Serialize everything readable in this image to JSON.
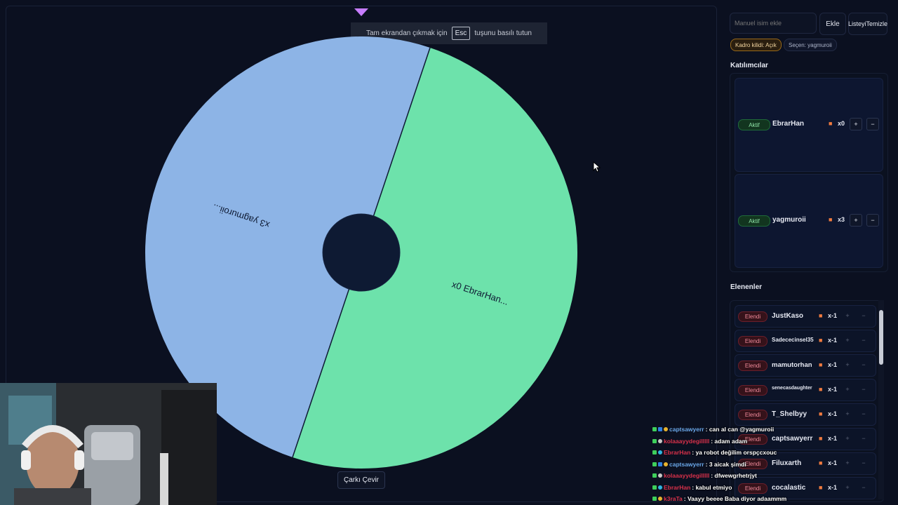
{
  "esc_hint": {
    "before": "Tam ekrandan çıkmak için",
    "key": "Esc",
    "after": "tuşunu basılı tutun"
  },
  "wheel": {
    "segments": [
      {
        "label": "x3 yagmuroii...",
        "color": "#8db4e6"
      },
      {
        "label": "x0 EbrarHan...",
        "color": "#6de2ab"
      }
    ],
    "border_color": "#c2123e",
    "hub_color": "#0e1a33"
  },
  "spin_button": "Çarkı Çevir",
  "panel": {
    "name_placeholder": "Manuel isim ekle",
    "add_label": "Ekle",
    "clear_label_1": "Listeyi",
    "clear_label_2": "Temizle",
    "lock_pill": "Kadro kilidi: Açık",
    "selected_pill": "Seçen: yagmuroii",
    "participants_title": "Katılımcılar",
    "eliminated_title": "Elenenler",
    "active_badge": "Aktif",
    "elim_badge": "Elendi",
    "participants": [
      {
        "name": "EbrarHan",
        "mult": "x0"
      },
      {
        "name": "yagmuroii",
        "mult": "x3"
      }
    ],
    "eliminated": [
      {
        "name": "JustKaso",
        "mult": "x-1"
      },
      {
        "name": "Sadececinsel35",
        "mult": "x-1"
      },
      {
        "name": "mamutorhan",
        "mult": "x-1"
      },
      {
        "name": "senecasdaughter",
        "mult": "x-1"
      },
      {
        "name": "T_Shelbyy",
        "mult": "x-1"
      },
      {
        "name": "captsawyerr",
        "mult": "x-1"
      },
      {
        "name": "Filuxarth",
        "mult": "x-1"
      },
      {
        "name": "cocalastic",
        "mult": "x-1"
      }
    ],
    "plus": "+",
    "minus": "−"
  },
  "chat": [
    {
      "user": "captsawyerr",
      "color": "#6aa7e8",
      "msg": ": can al can @yagmuroii"
    },
    {
      "user": "kolaaayydegilllll",
      "color": "#d9314a",
      "msg": ": adam adam"
    },
    {
      "user": "EbrarHan",
      "color": "#d9314a",
      "msg": ": ya robot değilim orspçcxouc"
    },
    {
      "user": "captsawyerr",
      "color": "#6aa7e8",
      "msg": ": 3 aicak şimdi"
    },
    {
      "user": "kolaaayydegilllll",
      "color": "#d9314a",
      "msg": ": dfwewgrhetrjyt"
    },
    {
      "user": "EbrarHan",
      "color": "#d9314a",
      "msg": ": kabul etmiyo"
    },
    {
      "user": "k3raTa",
      "color": "#d9314a",
      "msg": ": Vaayy beeee Baba diyor adaammm"
    }
  ]
}
